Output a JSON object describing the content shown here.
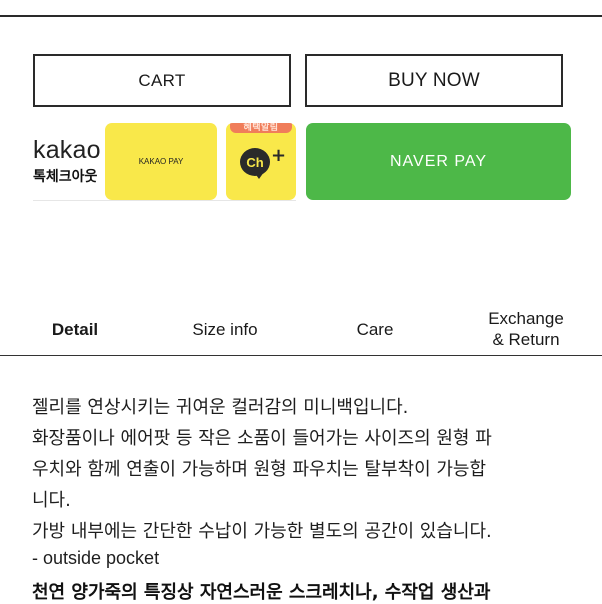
{
  "buttons": {
    "cart_label": "CART",
    "buy_now_label": "BUY NOW"
  },
  "payment": {
    "kakao_logo": "kakao",
    "kakao_subtitle": "톡체크아웃",
    "kakao_pay_label": "KAKAO PAY",
    "channel_banner": "혜택알림",
    "channel_icon_text": "Ch",
    "channel_icon_plus": "+",
    "naver_pay_label": "NAVER PAY",
    "colors": {
      "kakao_yellow": "#f9e84a",
      "naver_green": "#4db848",
      "banner_orange": "#f07d5a"
    }
  },
  "tabs": {
    "detail": "Detail",
    "size_info": "Size info",
    "care": "Care",
    "exchange_line1": "Exchange",
    "exchange_line2": "& Return",
    "active": "Detail"
  },
  "description": {
    "lines": [
      "젤리를 연상시키는 귀여운 컬러감의 미니백입니다.",
      "화장품이나 에어팟 등 작은 소품이 들어가는 사이즈의 원형 파",
      "우치와 함께 연출이 가능하며 원형 파우치는 탈부착이 가능합",
      "니다.",
      "가방 내부에는 간단한 수납이 가능한 별도의 공간이 있습니다.",
      "- outside pocket",
      "천연 양가죽의 특징상 자연스러운 스크레치나, 수작업 생산과"
    ]
  }
}
